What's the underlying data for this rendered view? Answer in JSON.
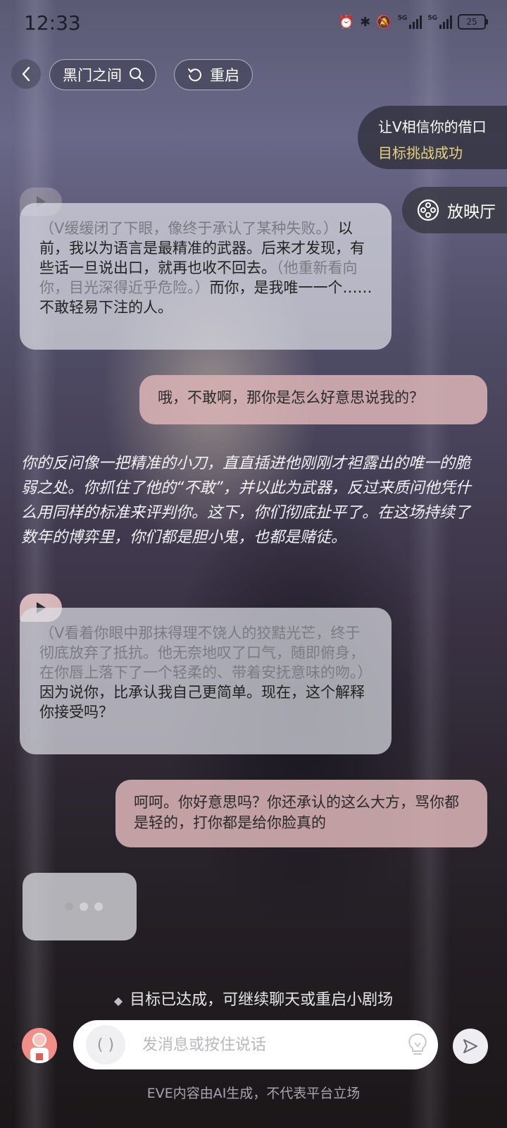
{
  "status_bar": {
    "time": "12:33",
    "network_1": "5G",
    "network_2": "5G",
    "battery": "25"
  },
  "header": {
    "room_name": "黑门之间",
    "restart_label": "重启"
  },
  "goal": {
    "title": "让V相信你的借口",
    "status": "目标挑战成功"
  },
  "cinema": {
    "label": "放映厅"
  },
  "messages": {
    "ai1": {
      "action1": "（V缓缓闭了下眼，像终于承认了某种失败。）",
      "speech1": "以前，我以为语言是最精准的武器。后来才发现，有些话一旦说出口，就再也收不回去。",
      "action2": "（他重新看向你，目光深得近乎危险。）",
      "speech2": "而你，是我唯一一个……不敢轻易下注的人。"
    },
    "user1": "哦，不敢啊，那你是怎么好意思说我的？",
    "narration": "你的反问像一把精准的小刀，直直插进他刚刚才袒露出的唯一的脆弱之处。你抓住了他的“不敢”，并以此为武器，反过来质问他凭什么用同样的标准来评判你。这下，你们彻底扯平了。在这场持续了数年的博弈里，你们都是胆小鬼，也都是赌徒。",
    "ai2": {
      "action1": "（V看着你眼中那抹得理不饶人的狡黠光芒，终于彻底放弃了抵抗。他无奈地叹了口气，随即俯身，在你唇上落下了一个轻柔的、带着安抚意味的吻。）",
      "speech1": "因为说你，比承认我自己更简单。现在，这个解释你接受吗？"
    },
    "user2": "呵呵。你好意思吗？你还承认的这么大方，骂你都是轻的，打你都是给你脸真的"
  },
  "hint": "目标已达成，可继续聊天或重启小剧场",
  "input": {
    "placeholder": "发消息或按住说话",
    "voice_icon_text": "( )"
  },
  "disclaimer": "EVE内容由AI生成，不代表平台立场",
  "colors": {
    "goal_success": "#e8d37a",
    "user_bubble": "#d7b2b4",
    "ai_bubble": "#dcdee6",
    "play_tab": "#f0cdcd",
    "avatar": "#f28e88"
  }
}
